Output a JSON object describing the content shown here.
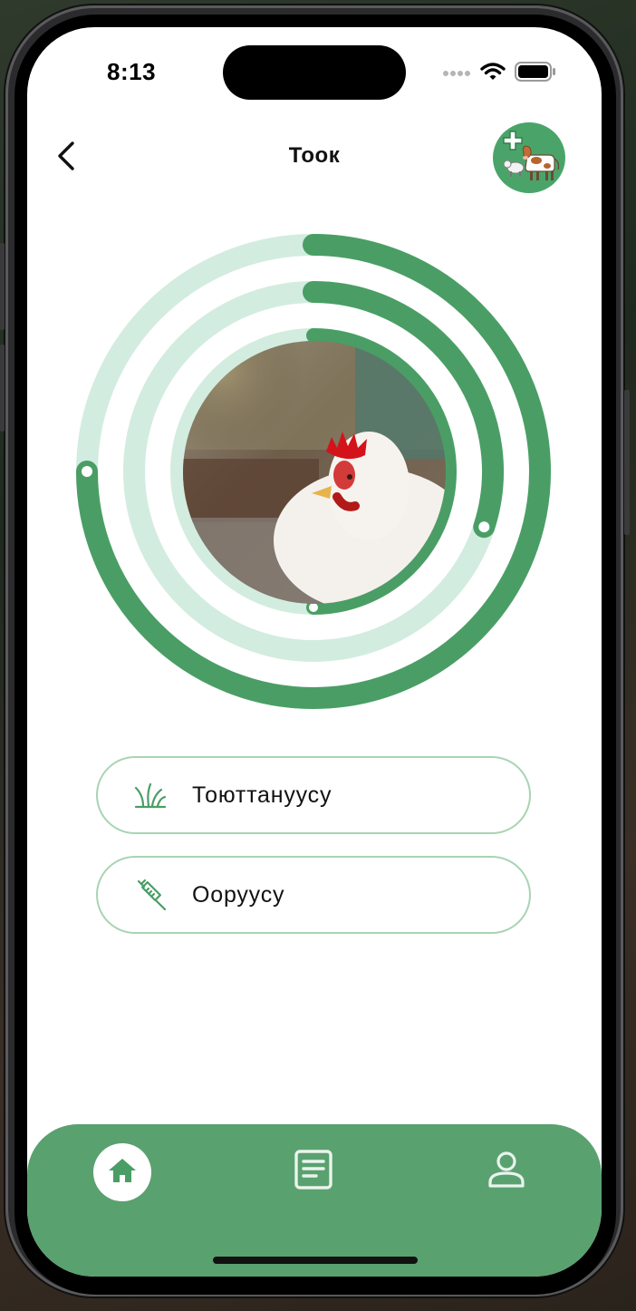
{
  "status_bar": {
    "time": "8:13"
  },
  "header": {
    "title": "Тоок",
    "back_icon": "chevron-left-icon",
    "avatar_icon": "add-livestock-icon"
  },
  "colors": {
    "accent": "#4a9e65",
    "ring_track": "#d3ece0",
    "tabbar": "#5aa170",
    "button_border": "#a8d4b3"
  },
  "progress_rings": [
    {
      "name": "outer",
      "progress": 0.75
    },
    {
      "name": "middle",
      "progress": 0.3
    },
    {
      "name": "inner",
      "progress": 0.5
    }
  ],
  "actions": [
    {
      "label": "Тоюттануусу",
      "icon": "grass-icon"
    },
    {
      "label": "Ооруусу",
      "icon": "syringe-icon"
    }
  ],
  "tabs": [
    {
      "icon": "home-icon",
      "active": true
    },
    {
      "icon": "document-icon",
      "active": false
    },
    {
      "icon": "profile-icon",
      "active": false
    }
  ]
}
